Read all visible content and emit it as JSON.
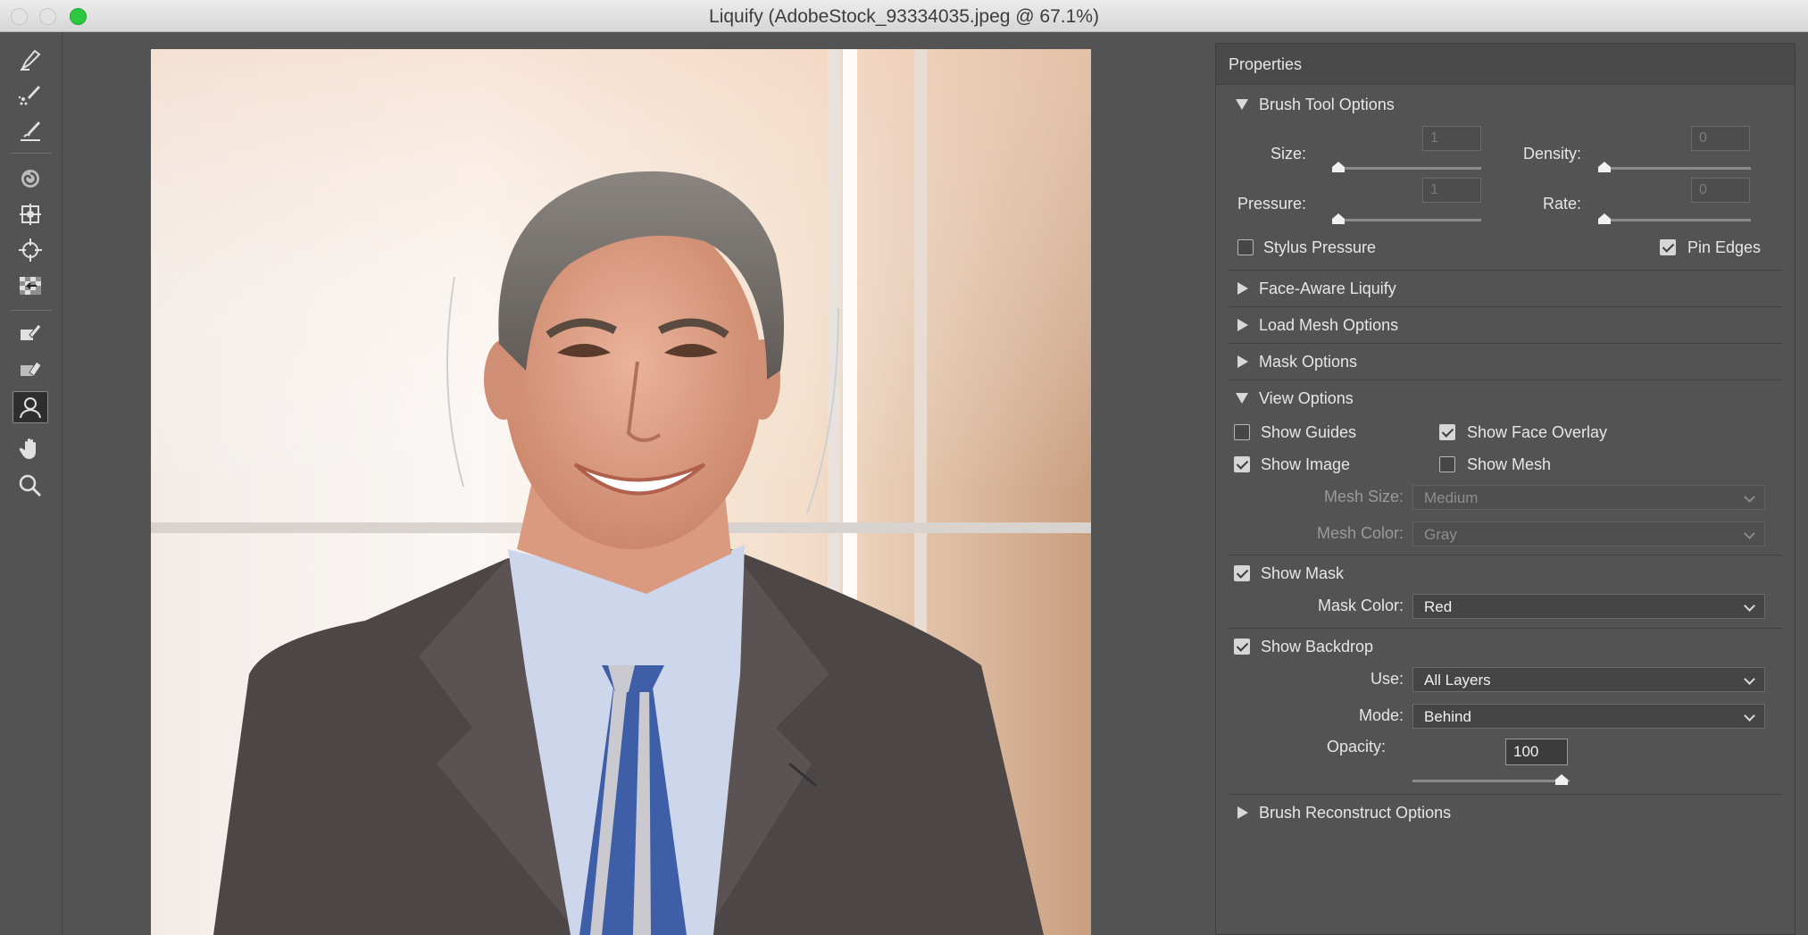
{
  "window": {
    "title": "Liquify (AdobeStock_93334035.jpeg @ 67.1%)"
  },
  "toolbar": {
    "tools": [
      {
        "name": "forward-warp-tool-icon"
      },
      {
        "name": "reconstruct-tool-icon"
      },
      {
        "name": "smooth-tool-icon"
      },
      {
        "name": "twirl-clockwise-tool-icon"
      },
      {
        "name": "pucker-tool-icon"
      },
      {
        "name": "bloat-tool-icon"
      },
      {
        "name": "push-left-tool-icon"
      },
      {
        "name": "freeze-mask-tool-icon"
      },
      {
        "name": "thaw-mask-tool-icon"
      },
      {
        "name": "face-tool-icon",
        "active": true
      },
      {
        "name": "hand-tool-icon"
      },
      {
        "name": "zoom-tool-icon"
      }
    ]
  },
  "panel": {
    "title": "Properties",
    "brush_tool_options": {
      "header": "Brush Tool Options",
      "size_label": "Size:",
      "size_value": "1",
      "density_label": "Density:",
      "density_value": "0",
      "pressure_label": "Pressure:",
      "pressure_value": "1",
      "rate_label": "Rate:",
      "rate_value": "0",
      "stylus_pressure_label": "Stylus Pressure",
      "stylus_pressure_checked": false,
      "pin_edges_label": "Pin Edges",
      "pin_edges_checked": true
    },
    "collapsed_sections": {
      "face_aware": "Face-Aware Liquify",
      "load_mesh": "Load Mesh Options",
      "mask": "Mask Options",
      "brush_reconstruct": "Brush Reconstruct Options"
    },
    "view_options": {
      "header": "View Options",
      "show_guides_label": "Show Guides",
      "show_guides_checked": false,
      "show_face_overlay_label": "Show Face Overlay",
      "show_face_overlay_checked": true,
      "show_image_label": "Show Image",
      "show_image_checked": true,
      "show_mesh_label": "Show Mesh",
      "show_mesh_checked": false,
      "mesh_size_label": "Mesh Size:",
      "mesh_size_value": "Medium",
      "mesh_color_label": "Mesh Color:",
      "mesh_color_value": "Gray",
      "show_mask_label": "Show Mask",
      "show_mask_checked": true,
      "mask_color_label": "Mask Color:",
      "mask_color_value": "Red",
      "show_backdrop_label": "Show Backdrop",
      "show_backdrop_checked": true,
      "use_label": "Use:",
      "use_value": "All Layers",
      "mode_label": "Mode:",
      "mode_value": "Behind",
      "opacity_label": "Opacity:",
      "opacity_value": "100"
    }
  }
}
